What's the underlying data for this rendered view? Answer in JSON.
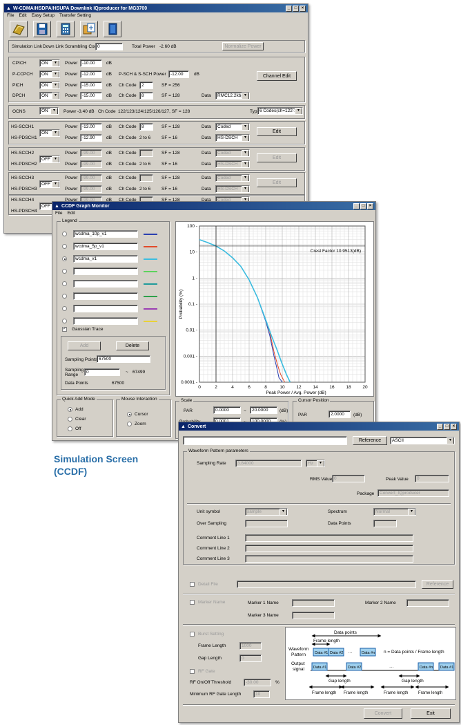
{
  "w1": {
    "title": "W-CDMA/HSDPA/HSUPA Downlink IQproducer for MG3700",
    "menu": [
      "File",
      "Edit",
      "Easy Setup",
      "Transfer Setting"
    ],
    "toolbar_icons": [
      "open-folder-icon",
      "save-icon",
      "calculator-icon",
      "export-icon",
      "book-icon"
    ],
    "sim": {
      "link_label": "Simulation Link",
      "link_value": "Down Link",
      "scr_label": "Scrambling Code",
      "scr_value": "0",
      "total_label": "Total Power",
      "total_value": "-2.60 dB",
      "btn": "Normalize Power"
    },
    "channels": [
      {
        "name": "CPICH",
        "on": "ON",
        "power": "-10.00",
        "unit": "dB",
        "code_label": "",
        "code": "",
        "sf": "",
        "extra": "",
        "data_label": "",
        "data": ""
      },
      {
        "name": "P-CCPCH",
        "on": "ON",
        "power": "-12.00",
        "unit": "dB",
        "code_label": "",
        "code": "",
        "sf": "",
        "extra": "P-SCH & S-SCH Power",
        "extra_val": "-12.00",
        "data_label": "",
        "data": ""
      },
      {
        "name": "PICH",
        "on": "ON",
        "power": "-15.00",
        "unit": "dB",
        "code_label": "Ch Code",
        "code": "2",
        "sf": "SF = 256",
        "extra": "",
        "data_label": "",
        "data": ""
      },
      {
        "name": "DPCH",
        "on": "ON",
        "power": "-15.00",
        "unit": "dB",
        "code_label": "Ch Code",
        "code": "8",
        "sf": "SF = 128",
        "extra": "",
        "data_label": "Data",
        "data": "RMC12.2kbps"
      }
    ],
    "ch_edit": "Channel Edit",
    "ocns": {
      "name": "OCNS",
      "on": "ON",
      "power_label": "Power",
      "power": "-3.40 dB",
      "code_label": "Ch Code",
      "codes": "122/123/124/125/126/127, SF = 128",
      "type_label": "Type",
      "type": "6 Codes(ch=122-127)"
    },
    "hs": [
      {
        "a": "HS-SCCH1",
        "b": "HS-PDSCH1",
        "on": "ON",
        "p1": "-13.00",
        "p2": "-12.90",
        "c1": "8",
        "c2": "2 to 6",
        "sf1": "SF = 128",
        "sf2": "SF = 16",
        "d1": "Coded",
        "d2": "HS-DSCH",
        "edit": "Edit",
        "enabled": true
      },
      {
        "a": "HS-SCCH2",
        "b": "HS-PDSCH2",
        "on": "OFF",
        "p1": "-99.00",
        "p2": "-99.00",
        "c1": "",
        "c2": "2 to 6",
        "sf1": "SF = 128",
        "sf2": "SF = 16",
        "d1": "Coded",
        "d2": "HS-DSCH",
        "edit": "Edit",
        "enabled": false
      },
      {
        "a": "HS-SCCH3",
        "b": "HS-PDSCH3",
        "on": "OFF",
        "p1": "-99.00",
        "p2": "-99.00",
        "c1": "",
        "c2": "2 to 6",
        "sf1": "SF = 128",
        "sf2": "SF = 16",
        "d1": "Coded",
        "d2": "HS-DSCH",
        "edit": "Edit",
        "enabled": false
      },
      {
        "a": "HS-SCCH4",
        "b": "HS-PDSCH4",
        "on": "OFF",
        "p1": "-99.00",
        "p2": "",
        "c1": "",
        "c2": "",
        "sf1": "SF = 128",
        "sf2": "",
        "d1": "Coded",
        "d2": "",
        "edit": "",
        "enabled": false
      }
    ],
    "power_label": "Power",
    "code_label": "Ch Code",
    "data_label": "Data",
    "db": "dB"
  },
  "w2": {
    "title": "CCDF Graph Monitor",
    "menu": [
      "File",
      "Edit"
    ],
    "legend_title": "Legend",
    "legend": [
      {
        "name": "wcdma_10p_v1",
        "color": "#2a3fb0",
        "checked": false
      },
      {
        "name": "wcdma_5p_v1",
        "color": "#e24a2a",
        "checked": false
      },
      {
        "name": "wcdma_v1",
        "color": "#3bbde0",
        "checked": true
      },
      {
        "name": "",
        "color": "#5dd35d",
        "checked": false
      },
      {
        "name": "",
        "color": "#1f9b9b",
        "checked": false
      },
      {
        "name": "",
        "color": "#2ea04a",
        "checked": false
      },
      {
        "name": "",
        "color": "#9b3fb3",
        "checked": false
      },
      {
        "name": "",
        "color": "#e9d238",
        "checked": false
      }
    ],
    "gauss": "Gaussian Trace",
    "add": "Add",
    "delete": "Delete",
    "sp_label": "Sampling Points",
    "sp_value": "67500",
    "sr_label1": "Sampling",
    "sr_label2": "Range",
    "sr_from": "0",
    "sr_to": "67499",
    "dp_label": "Data Points",
    "dp_value": "67500",
    "qa_title": "Quick Add Mode",
    "qa": [
      "Add",
      "Clear",
      "Off"
    ],
    "mi_title": "Mouse Interaction",
    "mi": [
      "Cursor",
      "Zoom"
    ],
    "scale_title": "Scale",
    "par_label": "PAR",
    "par_from": "0.0000",
    "par_to": "20.0000",
    "par_unit": "(dB)",
    "prob_label": "Probability",
    "prob_from": "0.0001",
    "prob_to": "100.0000",
    "prob_unit": "(%)",
    "cursor_title": "Cursor Position",
    "cursor_par_label": "PAR",
    "cursor_par": "2.0000",
    "cursor_unit": "(dB)",
    "crest": "Crest Factor 10.9513(dB)"
  },
  "chart_data": {
    "type": "line",
    "xlabel": "Peak Power / Avg. Power (dB)",
    "ylabel": "Probability (%)",
    "xlim": [
      0,
      20
    ],
    "ylim": [
      0.0001,
      100
    ],
    "yscale": "log",
    "xticks": [
      0,
      2,
      4,
      6,
      8,
      10,
      12,
      14,
      16,
      18,
      20
    ],
    "yticks": [
      "100",
      "10",
      "1",
      "0.1",
      "0.01",
      "0.001",
      "0.0001"
    ],
    "cursor_x": 2.0,
    "series": [
      {
        "name": "wcdma_10p_v1",
        "x": [
          0,
          1,
          2,
          3,
          4,
          5,
          6,
          7,
          8,
          8.5,
          9,
          9.3,
          9.6,
          10.0
        ],
        "y": [
          30,
          23,
          17,
          11,
          6,
          2.8,
          0.85,
          0.18,
          0.022,
          0.006,
          0.001,
          0.0004,
          0.00015,
          0.0001
        ]
      },
      {
        "name": "wcdma_5p_v1",
        "x": [
          0,
          1,
          2,
          3,
          4,
          5,
          6,
          7,
          8,
          8.5,
          9,
          9.4,
          9.8,
          10.3
        ],
        "y": [
          30,
          23,
          17,
          11,
          6,
          2.8,
          0.85,
          0.18,
          0.025,
          0.008,
          0.0015,
          0.0005,
          0.0002,
          0.0001
        ]
      },
      {
        "name": "wcdma_v1",
        "x": [
          0,
          1,
          2,
          3,
          4,
          5,
          6,
          7,
          8,
          8.7,
          9.3,
          9.9,
          10.5,
          10.95
        ],
        "y": [
          30,
          23,
          17,
          11,
          6,
          2.8,
          0.85,
          0.18,
          0.025,
          0.006,
          0.002,
          0.0006,
          0.0002,
          0.0001
        ]
      }
    ]
  },
  "caption": {
    "line1": "Simulation Screen",
    "line2": "(CCDF)"
  },
  "w3": {
    "title": "Convert",
    "reference": "Reference",
    "format": "ASCII",
    "wp_title": "Waveform Pattern parameters",
    "sr_label": "Sampling Rate",
    "sr_value": "3.84000",
    "sr_unit": "Hz",
    "rms_label": "RMS Value",
    "rms_value": "0",
    "peak_label": "Peak Value",
    "peak_value": "0",
    "pkg_label": "Package",
    "pkg_value": "Convert_IQproducer",
    "unit_label": "Unit symbol",
    "unit_value": "sample",
    "spec_label": "Spectrum",
    "spec_value": "Normal",
    "os_label": "Over Sampling",
    "dp_label": "Data Points",
    "cl1": "Comment Line 1",
    "cl2": "Comment Line 2",
    "cl3": "Comment Line 3",
    "detail": "Detail File",
    "reference2": "Reference",
    "marker_name": "Marker Name",
    "m1": "Marker 1 Name",
    "m2": "Marker 2 Name",
    "m3": "Marker 3 Name",
    "burst": "Burst Setting",
    "frame_len": "Frame Length",
    "frame_val": "1000",
    "gap_len": "Gap Length",
    "gap_val": "0",
    "rf_gate": "RF Gate",
    "rf_thr": "RF On/Off Threshold",
    "rf_thr_val": "-30.00",
    "rf_unit": "%",
    "min_rf": "Minimum RF Gate Length",
    "min_rf_val": "10",
    "convert": "Convert",
    "exit": "Exit",
    "diagram": {
      "data_points": "Data points",
      "frame_length_top": "Frame length",
      "waveform1": "Waveform",
      "waveform2": "Pattern",
      "cells": [
        "Data #1",
        "Data #2",
        "···",
        "Data #n"
      ],
      "formula": "n = Data points / Frame length",
      "output1": "Output",
      "output2": "signal",
      "out_cells": [
        "Data #1",
        "Data #2",
        "···",
        "Data #n",
        "Data #1"
      ],
      "gap1": "Gap length",
      "gap2": "Gap length",
      "fl": [
        "Frame length",
        "Frame length",
        "Frame length",
        "Frame length"
      ]
    }
  }
}
